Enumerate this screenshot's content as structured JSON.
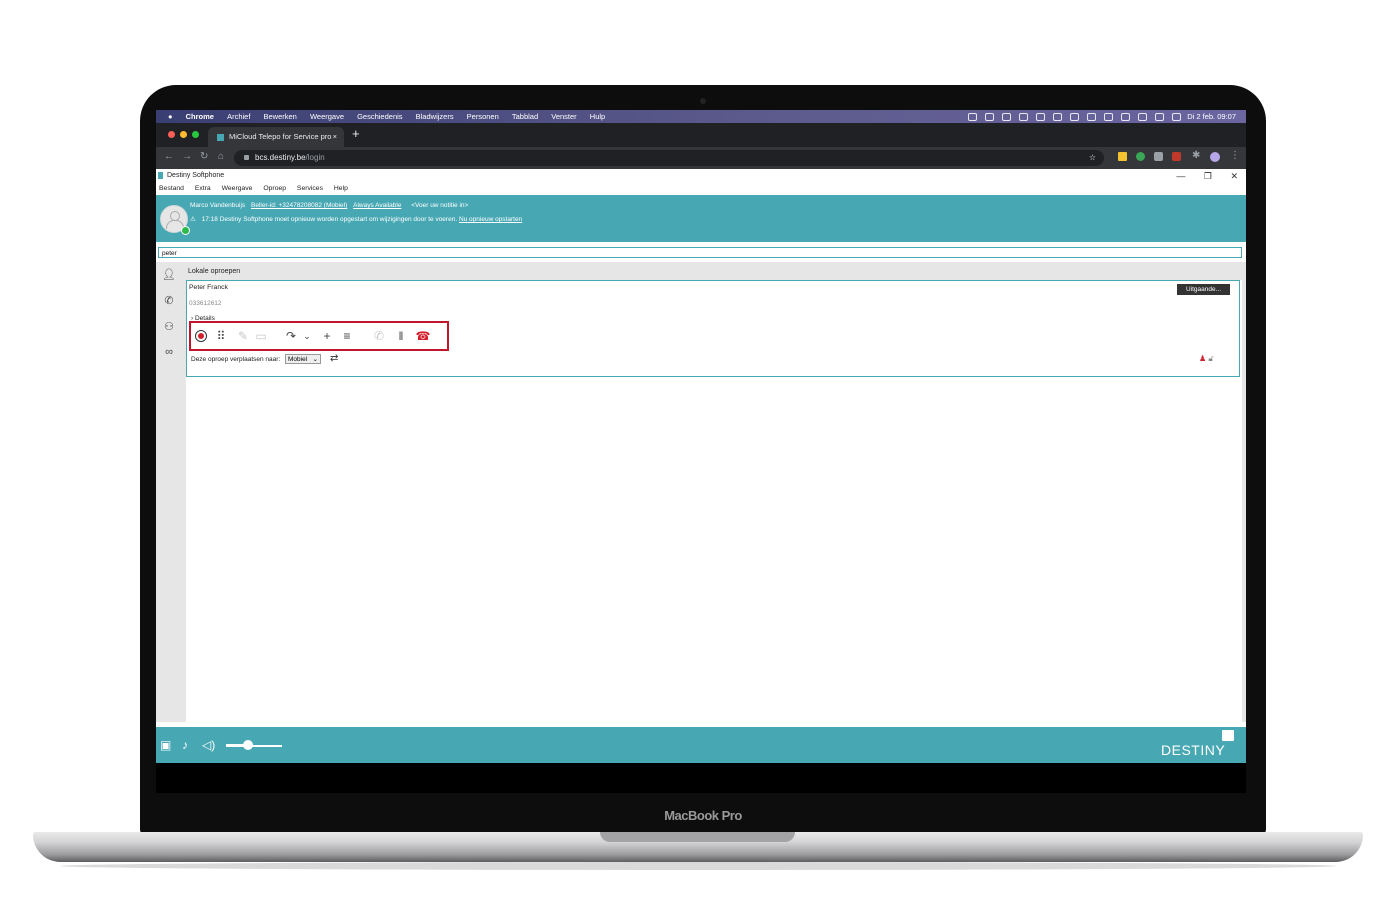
{
  "macos": {
    "app_name": "Chrome",
    "menus": [
      "Archief",
      "Bewerken",
      "Weergave",
      "Geschiedenis",
      "Bladwijzers",
      "Personen",
      "Tabblad",
      "Venster",
      "Hulp"
    ],
    "datetime": "Di 2 feb.  09:07"
  },
  "browser": {
    "tab_title": "MiCloud Telepo for Service pro",
    "tab_close": "×",
    "new_tab": "+",
    "url_host": "bcs.destiny.be",
    "url_path": "/login"
  },
  "app": {
    "window_title": "Destiny Softphone",
    "menu": [
      "Bestand",
      "Extra",
      "Weergave",
      "Oproep",
      "Services",
      "Help"
    ],
    "user_name": "Marco Vandenbuijs",
    "caller_id": "Beller-id: +32478208082 (Mobiel)",
    "availability": "Always Available",
    "note_placeholder": "<Voer uw notitie in>",
    "notice_time": "17:18",
    "notice_text": "Destiny Softphone moet opnieuw worden opgestart om wijzigingen door te voeren.",
    "notice_link": "Nu opnieuw opstarten",
    "search_value": "peter",
    "section_title": "Lokale oproepen"
  },
  "call": {
    "contact_name": "Peter Franck",
    "number": "033612612",
    "details_label": "Details",
    "direction_badge": "Uitgaande...",
    "move_label": "Deze oproep verplaatsen naar:",
    "move_option": "Mobiel"
  },
  "brand": {
    "logo_text": "DESTINY",
    "laptop_label": "MacBook Pro"
  },
  "colors": {
    "teal": "#47a8b4",
    "highlight_red": "#c0162c",
    "hangup_red": "#d21f2b"
  }
}
